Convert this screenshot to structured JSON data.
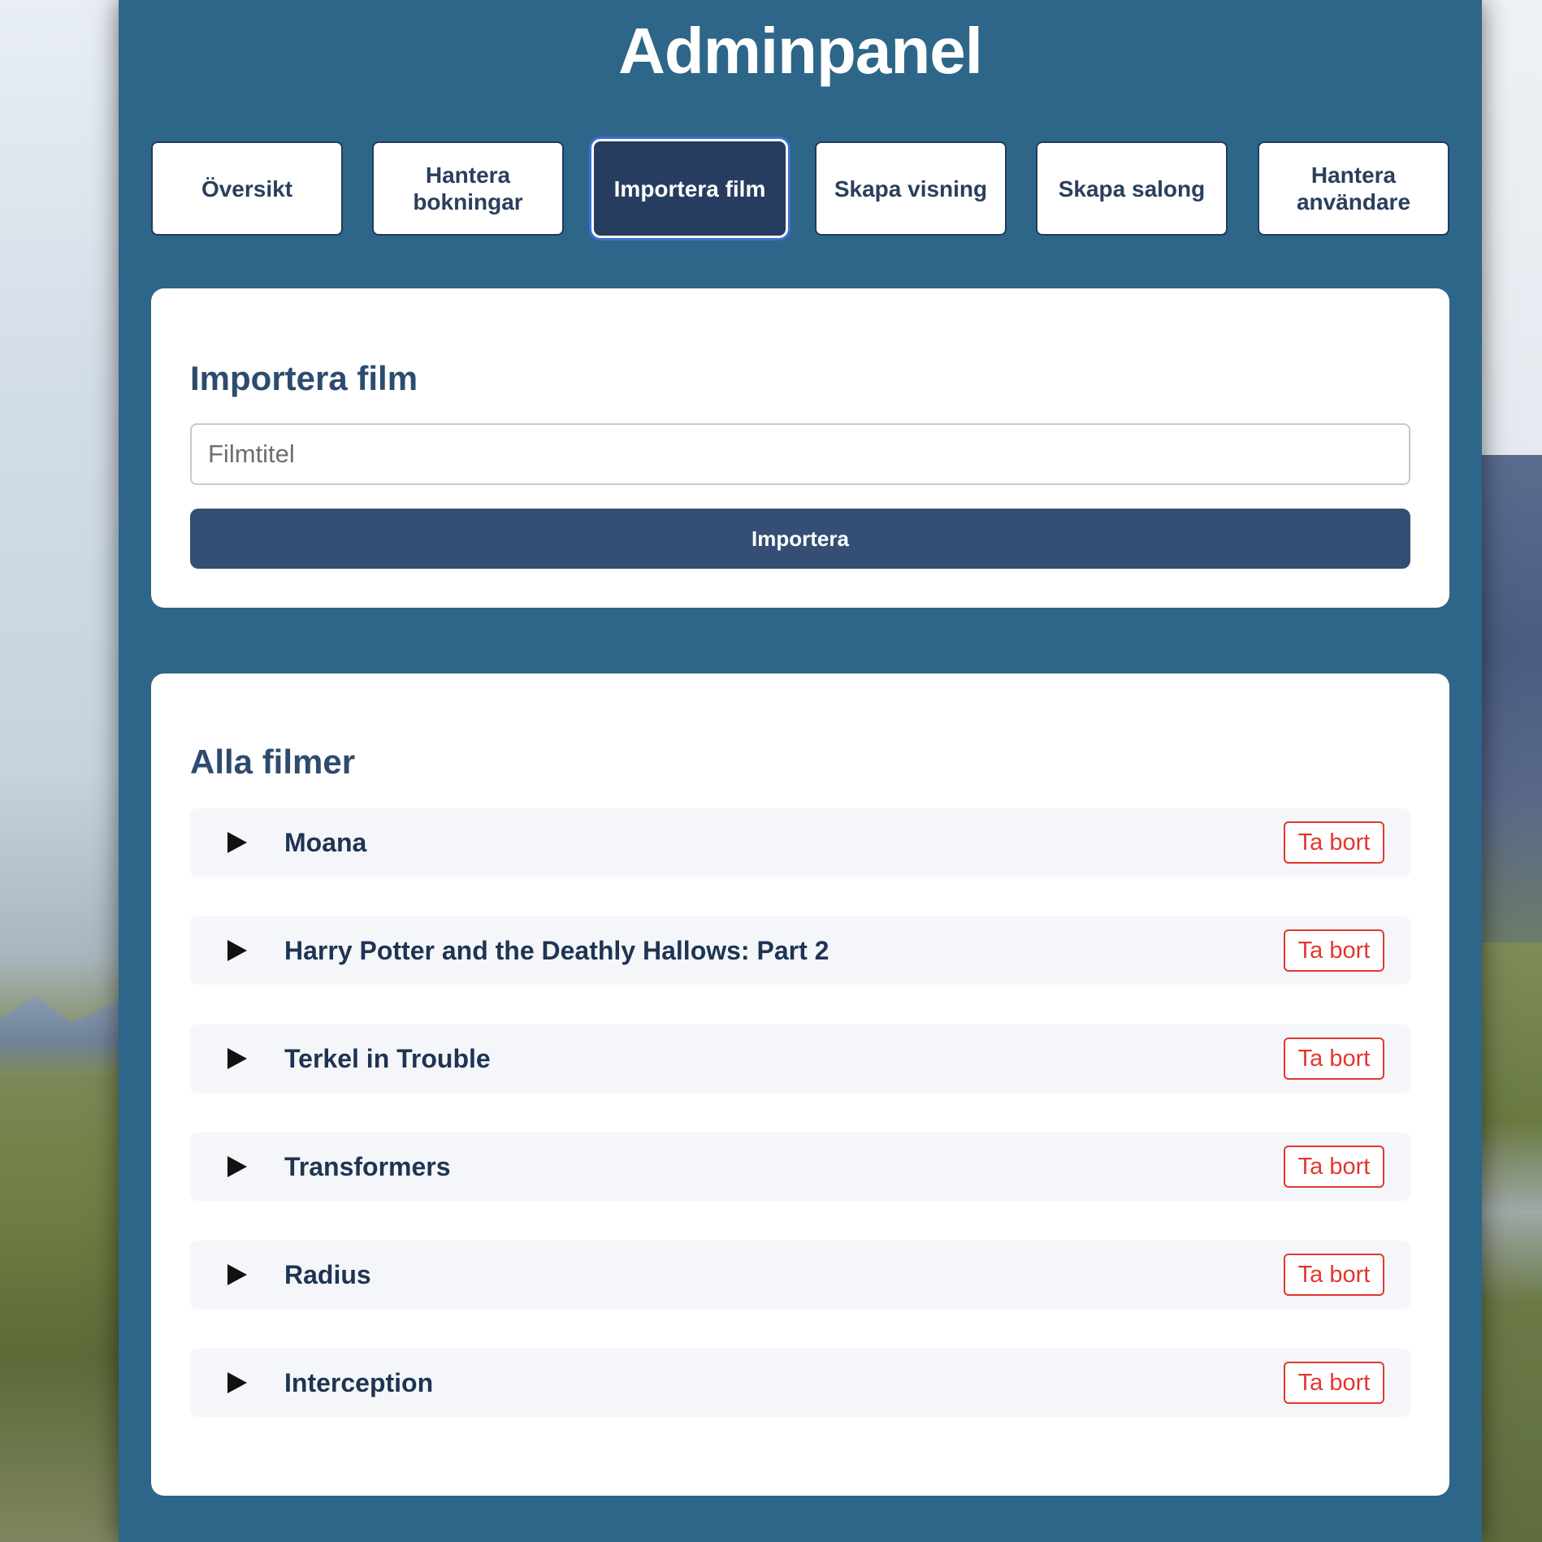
{
  "header": {
    "title": "Adminpanel"
  },
  "tabs": [
    {
      "label": "Översikt",
      "active": false
    },
    {
      "label": "Hantera bokningar",
      "active": false
    },
    {
      "label": "Importera film",
      "active": true
    },
    {
      "label": "Skapa visning",
      "active": false
    },
    {
      "label": "Skapa salong",
      "active": false
    },
    {
      "label": "Hantera användare",
      "active": false
    }
  ],
  "import": {
    "heading": "Importera film",
    "input_placeholder": "Filmtitel",
    "input_value": "",
    "button_label": "Importera"
  },
  "films": {
    "heading": "Alla filmer",
    "delete_label": "Ta bort",
    "items": [
      {
        "title": "Moana"
      },
      {
        "title": "Harry Potter and the Deathly Hallows: Part 2"
      },
      {
        "title": "Terkel in Trouble"
      },
      {
        "title": "Transformers"
      },
      {
        "title": "Radius"
      },
      {
        "title": "Interception"
      }
    ]
  },
  "colors": {
    "panel_bg": "#2d6689",
    "active_tab_bg": "#263d5f",
    "primary_button": "#344f73",
    "danger": "#e2372f",
    "heading": "#2d4b6d"
  },
  "icons": {
    "expand": "play-triangle-icon"
  }
}
